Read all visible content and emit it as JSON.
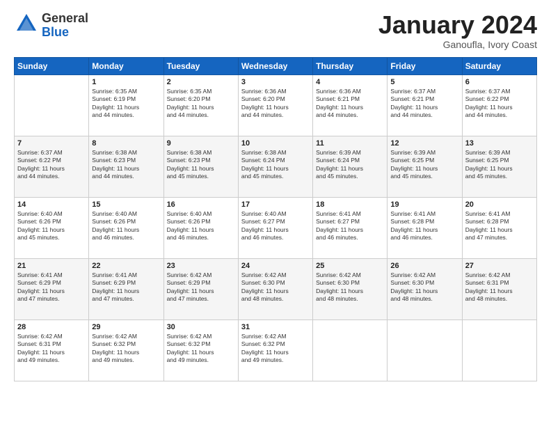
{
  "logo": {
    "general": "General",
    "blue": "Blue"
  },
  "title": "January 2024",
  "subtitle": "Ganoufla, Ivory Coast",
  "days_of_week": [
    "Sunday",
    "Monday",
    "Tuesday",
    "Wednesday",
    "Thursday",
    "Friday",
    "Saturday"
  ],
  "weeks": [
    [
      {
        "day": "",
        "info": ""
      },
      {
        "day": "1",
        "info": "Sunrise: 6:35 AM\nSunset: 6:19 PM\nDaylight: 11 hours\nand 44 minutes."
      },
      {
        "day": "2",
        "info": "Sunrise: 6:35 AM\nSunset: 6:20 PM\nDaylight: 11 hours\nand 44 minutes."
      },
      {
        "day": "3",
        "info": "Sunrise: 6:36 AM\nSunset: 6:20 PM\nDaylight: 11 hours\nand 44 minutes."
      },
      {
        "day": "4",
        "info": "Sunrise: 6:36 AM\nSunset: 6:21 PM\nDaylight: 11 hours\nand 44 minutes."
      },
      {
        "day": "5",
        "info": "Sunrise: 6:37 AM\nSunset: 6:21 PM\nDaylight: 11 hours\nand 44 minutes."
      },
      {
        "day": "6",
        "info": "Sunrise: 6:37 AM\nSunset: 6:22 PM\nDaylight: 11 hours\nand 44 minutes."
      }
    ],
    [
      {
        "day": "7",
        "info": "Sunrise: 6:37 AM\nSunset: 6:22 PM\nDaylight: 11 hours\nand 44 minutes."
      },
      {
        "day": "8",
        "info": "Sunrise: 6:38 AM\nSunset: 6:23 PM\nDaylight: 11 hours\nand 44 minutes."
      },
      {
        "day": "9",
        "info": "Sunrise: 6:38 AM\nSunset: 6:23 PM\nDaylight: 11 hours\nand 45 minutes."
      },
      {
        "day": "10",
        "info": "Sunrise: 6:38 AM\nSunset: 6:24 PM\nDaylight: 11 hours\nand 45 minutes."
      },
      {
        "day": "11",
        "info": "Sunrise: 6:39 AM\nSunset: 6:24 PM\nDaylight: 11 hours\nand 45 minutes."
      },
      {
        "day": "12",
        "info": "Sunrise: 6:39 AM\nSunset: 6:25 PM\nDaylight: 11 hours\nand 45 minutes."
      },
      {
        "day": "13",
        "info": "Sunrise: 6:39 AM\nSunset: 6:25 PM\nDaylight: 11 hours\nand 45 minutes."
      }
    ],
    [
      {
        "day": "14",
        "info": "Sunrise: 6:40 AM\nSunset: 6:26 PM\nDaylight: 11 hours\nand 45 minutes."
      },
      {
        "day": "15",
        "info": "Sunrise: 6:40 AM\nSunset: 6:26 PM\nDaylight: 11 hours\nand 46 minutes."
      },
      {
        "day": "16",
        "info": "Sunrise: 6:40 AM\nSunset: 6:26 PM\nDaylight: 11 hours\nand 46 minutes."
      },
      {
        "day": "17",
        "info": "Sunrise: 6:40 AM\nSunset: 6:27 PM\nDaylight: 11 hours\nand 46 minutes."
      },
      {
        "day": "18",
        "info": "Sunrise: 6:41 AM\nSunset: 6:27 PM\nDaylight: 11 hours\nand 46 minutes."
      },
      {
        "day": "19",
        "info": "Sunrise: 6:41 AM\nSunset: 6:28 PM\nDaylight: 11 hours\nand 46 minutes."
      },
      {
        "day": "20",
        "info": "Sunrise: 6:41 AM\nSunset: 6:28 PM\nDaylight: 11 hours\nand 47 minutes."
      }
    ],
    [
      {
        "day": "21",
        "info": "Sunrise: 6:41 AM\nSunset: 6:29 PM\nDaylight: 11 hours\nand 47 minutes."
      },
      {
        "day": "22",
        "info": "Sunrise: 6:41 AM\nSunset: 6:29 PM\nDaylight: 11 hours\nand 47 minutes."
      },
      {
        "day": "23",
        "info": "Sunrise: 6:42 AM\nSunset: 6:29 PM\nDaylight: 11 hours\nand 47 minutes."
      },
      {
        "day": "24",
        "info": "Sunrise: 6:42 AM\nSunset: 6:30 PM\nDaylight: 11 hours\nand 48 minutes."
      },
      {
        "day": "25",
        "info": "Sunrise: 6:42 AM\nSunset: 6:30 PM\nDaylight: 11 hours\nand 48 minutes."
      },
      {
        "day": "26",
        "info": "Sunrise: 6:42 AM\nSunset: 6:30 PM\nDaylight: 11 hours\nand 48 minutes."
      },
      {
        "day": "27",
        "info": "Sunrise: 6:42 AM\nSunset: 6:31 PM\nDaylight: 11 hours\nand 48 minutes."
      }
    ],
    [
      {
        "day": "28",
        "info": "Sunrise: 6:42 AM\nSunset: 6:31 PM\nDaylight: 11 hours\nand 49 minutes."
      },
      {
        "day": "29",
        "info": "Sunrise: 6:42 AM\nSunset: 6:32 PM\nDaylight: 11 hours\nand 49 minutes."
      },
      {
        "day": "30",
        "info": "Sunrise: 6:42 AM\nSunset: 6:32 PM\nDaylight: 11 hours\nand 49 minutes."
      },
      {
        "day": "31",
        "info": "Sunrise: 6:42 AM\nSunset: 6:32 PM\nDaylight: 11 hours\nand 49 minutes."
      },
      {
        "day": "",
        "info": ""
      },
      {
        "day": "",
        "info": ""
      },
      {
        "day": "",
        "info": ""
      }
    ]
  ]
}
